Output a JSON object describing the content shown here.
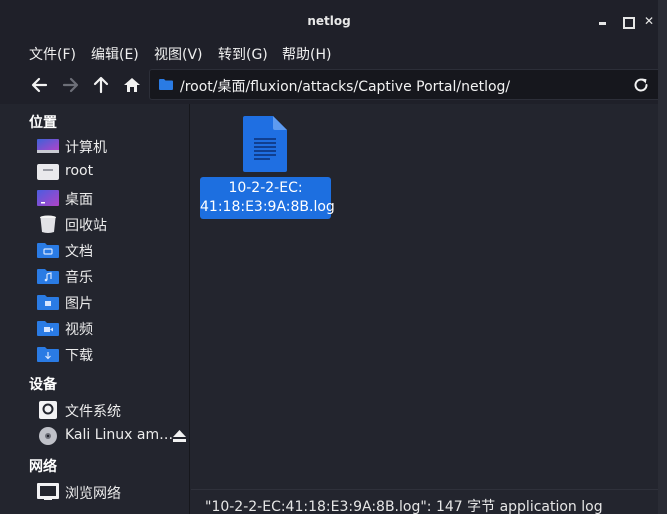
{
  "window": {
    "title": "netlog"
  },
  "menu": [
    "文件(F)",
    "编辑(E)",
    "视图(V)",
    "转到(G)",
    "帮助(H)"
  ],
  "location": {
    "path": "/root/桌面/fluxion/attacks/Captive Portal/netlog/"
  },
  "sidebar": {
    "sections": {
      "places": "位置",
      "devices": "设备",
      "network": "网络"
    },
    "places": [
      {
        "label": "计算机",
        "icon": "computer-icon"
      },
      {
        "label": "root",
        "icon": "home-folder-icon"
      },
      {
        "label": "桌面",
        "icon": "desktop-icon"
      },
      {
        "label": "回收站",
        "icon": "trash-icon"
      },
      {
        "label": "文档",
        "icon": "documents-folder-icon"
      },
      {
        "label": "音乐",
        "icon": "music-folder-icon"
      },
      {
        "label": "图片",
        "icon": "pictures-folder-icon"
      },
      {
        "label": "视频",
        "icon": "videos-folder-icon"
      },
      {
        "label": "下载",
        "icon": "downloads-folder-icon"
      }
    ],
    "devices": [
      {
        "label": "文件系统",
        "icon": "drive-icon"
      },
      {
        "label": "Kali Linux am…",
        "icon": "optical-disc-icon"
      }
    ],
    "network": [
      {
        "label": "浏览网络",
        "icon": "network-icon"
      }
    ]
  },
  "files": [
    {
      "name": "10-2-2-EC:\n41:18:E3:9A:8B.log",
      "icon": "text-file-icon"
    }
  ],
  "status": "\"10-2-2-EC:41:18:E3:9A:8B.log\": 147 字节 application log",
  "colors": {
    "accent": "#1d6fe0",
    "folder": "#2a7be4",
    "background": "#23252e"
  }
}
